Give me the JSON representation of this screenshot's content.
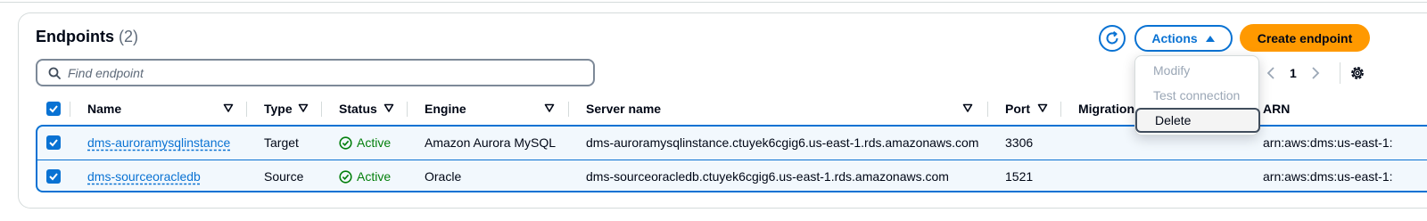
{
  "header": {
    "title": "Endpoints",
    "count": "(2)"
  },
  "toolbar": {
    "actions_label": "Actions",
    "create_label": "Create endpoint"
  },
  "search": {
    "placeholder": "Find endpoint"
  },
  "pagination": {
    "current_page": "1"
  },
  "actions_menu": {
    "items": [
      {
        "label": "Modify",
        "enabled": false
      },
      {
        "label": "Test connection",
        "enabled": false
      },
      {
        "label": "Delete",
        "enabled": true
      }
    ]
  },
  "table": {
    "columns": {
      "name": "Name",
      "type": "Type",
      "status": "Status",
      "engine": "Engine",
      "server_name": "Server name",
      "port": "Port",
      "migration": "Migration",
      "arn": "ARN"
    },
    "rows": [
      {
        "name": "dms-auroramysqlinstance",
        "type": "Target",
        "status": "Active",
        "engine": "Amazon Aurora MySQL",
        "server_name": "dms-auroramysqlinstance.ctuyek6cgig6.us-east-1.rds.amazonaws.com",
        "port": "3306",
        "arn": "arn:aws:dms:us-east-1:"
      },
      {
        "name": "dms-sourceoracledb",
        "type": "Source",
        "status": "Active",
        "engine": "Oracle",
        "server_name": "dms-sourceoracledb.ctuyek6cgig6.us-east-1.rds.amazonaws.com",
        "port": "1521",
        "arn": "arn:aws:dms:us-east-1:"
      }
    ]
  },
  "colors": {
    "primary": "#0972d3",
    "accent": "#ff9900",
    "success": "#037f0c",
    "selected_row_bg": "#f2f8fd"
  }
}
